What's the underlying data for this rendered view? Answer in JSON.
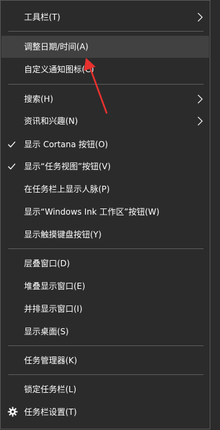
{
  "menu": {
    "toolbars": "工具栏(T)",
    "adjust_datetime": "调整日期/时间(A)",
    "customize_notification_icons": "自定义通知图标(C)",
    "search": "搜索(H)",
    "news_interests": "资讯和兴趣(N)",
    "show_cortana": "显示 Cortana 按钮(O)",
    "show_task_view": "显示“任务视图”按钮(V)",
    "show_people": "在任务栏上显示人脉(P)",
    "show_windows_ink": "显示“Windows Ink 工作区”按钮(W)",
    "show_touch_keyboard": "显示触摸键盘按钮(Y)",
    "cascade_windows": "层叠窗口(D)",
    "stack_windows": "堆叠显示窗口(E)",
    "side_by_side": "并排显示窗口(I)",
    "show_desktop": "显示桌面(S)",
    "task_manager": "任务管理器(K)",
    "lock_taskbar": "锁定任务栏(L)",
    "taskbar_settings": "任务栏设置(T)"
  },
  "state": {
    "hovered_item": "调整日期/时间(A)",
    "checked_items": [
      "显示 Cortana 按钮(O)",
      "显示“任务视图”按钮(V)"
    ]
  },
  "colors": {
    "menu_background": "#2b2b2b",
    "hover_background": "#414141",
    "separator": "#5c5c5c",
    "annotation_arrow": "#e8312f"
  },
  "icons": {
    "submenu": "chevron-right-icon",
    "checked": "checkmark-icon",
    "settings": "gear-icon"
  }
}
